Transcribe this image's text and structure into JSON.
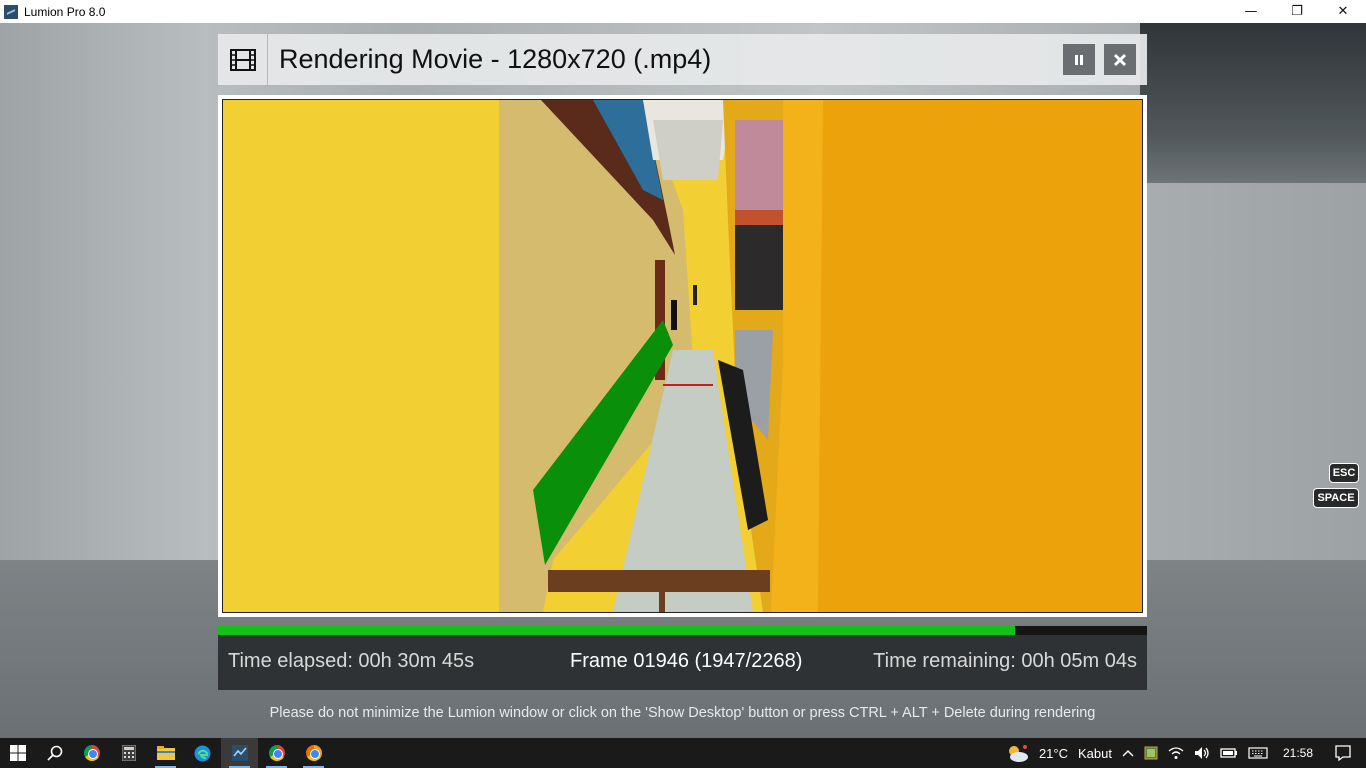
{
  "window": {
    "title": "Lumion Pro 8.0",
    "minimize": "—",
    "restore": "❐",
    "close": "✕"
  },
  "render_dialog": {
    "title": "Rendering Movie - 1280x720 (.mp4)",
    "pause_icon": "pause-icon",
    "close_icon": "close-icon",
    "progress": 0.858,
    "time_elapsed": "Time elapsed: 00h 30m 45s",
    "frame": "Frame 01946 (1947/2268)",
    "time_remaining": "Time remaining: 00h 05m 04s",
    "warning": "Please do not minimize the Lumion window or click on the 'Show Desktop' button or press CTRL + ALT + Delete during rendering",
    "accent_color": "#13c217"
  },
  "key_hints": {
    "esc": "ESC",
    "space": "SPACE"
  },
  "taskbar": {
    "weather_temp": "21°C",
    "weather_desc": "Kabut",
    "clock": "21:58",
    "apps": [
      "start-icon",
      "search-icon",
      "chrome-icon",
      "calculator-icon",
      "file-explorer-icon",
      "edge-icon",
      "lumion-icon",
      "chrome-icon",
      "chrome-canary-icon"
    ]
  }
}
